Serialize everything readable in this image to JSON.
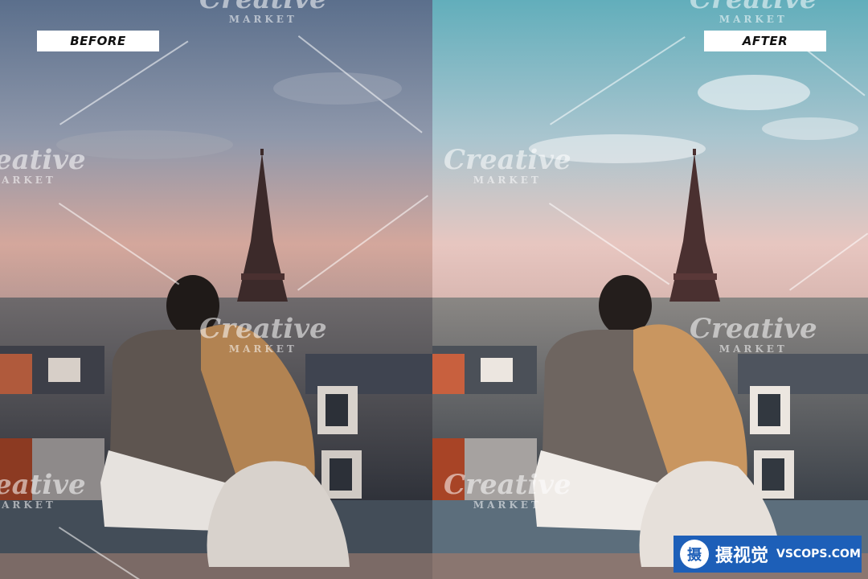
{
  "labels": {
    "before": "BEFORE",
    "after": "AFTER"
  },
  "watermark": {
    "brand": "Creative",
    "sub": "MARKET"
  },
  "badge": {
    "logo_glyph": "摄",
    "cn_text": "摄视觉",
    "en_text": "VSCOPS.COM"
  },
  "colors": {
    "before_sky_top": "#5b6f8c",
    "before_sky_bottom": "#d4a79c",
    "after_sky_top": "#62aebb",
    "after_sky_bottom": "#e7c6c0",
    "badge_bg": "#1d5fb8"
  }
}
